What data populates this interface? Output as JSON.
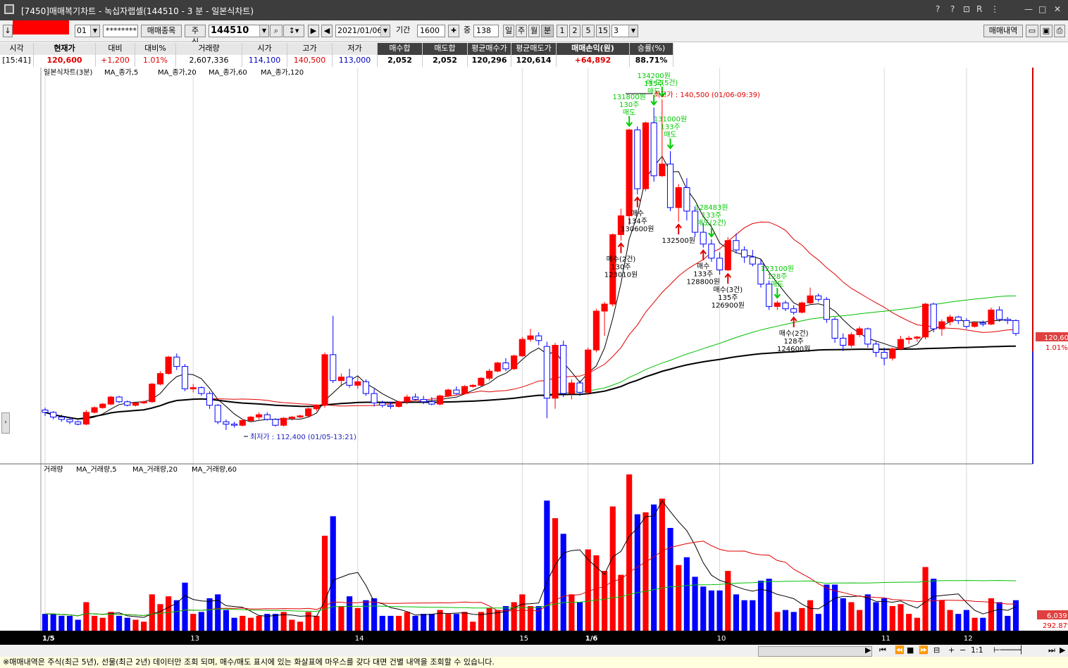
{
  "window": {
    "title": "[7450]매매복기차트 - 녹십자랩셀(144510 - 3 분 - 일본식차트)",
    "controls": [
      "?",
      "?",
      "⊡",
      "R",
      "⋮",
      "—",
      "□",
      "✕"
    ]
  },
  "toolbar": {
    "account_no": "01",
    "password": "********",
    "item_button": "매매종목",
    "type_label": "주식",
    "code": "144510",
    "date": "2021/01/06",
    "period_label": "기간",
    "period_value": "1600",
    "mid_label": "중",
    "mid_value": "138",
    "period_buttons": [
      "일",
      "주",
      "월",
      "분",
      "1",
      "2",
      "5",
      "15"
    ],
    "minute_value": "3",
    "trade_history_button": "매매내역",
    "arrow_left": "↓"
  },
  "summary": {
    "headers": [
      "시각",
      "현재가",
      "대비",
      "대비%",
      "거래량",
      "시가",
      "고가",
      "저가",
      "매수합",
      "매도합",
      "평균매수가",
      "평균매도가",
      "매매손익(원)",
      "승률(%)"
    ],
    "values": [
      "[15:41]",
      "120,600",
      "+1,200",
      "1.01%",
      "2,607,336",
      "114,100",
      "140,500",
      "113,000",
      "2,052",
      "2,052",
      "120,296",
      "120,614",
      "+64,892",
      "88.71%"
    ],
    "value_colors": [
      "#000000",
      "#e00000",
      "#e00000",
      "#e00000",
      "#000000",
      "#0000c0",
      "#e00000",
      "#0000c0",
      "#000000",
      "#000000",
      "#000000",
      "#000000",
      "#e00000",
      "#000000"
    ]
  },
  "price_panel": {
    "legend": [
      {
        "text": "일본식차트(3분)",
        "color": "#000000"
      },
      {
        "text": "MA_종가,5",
        "color": "#000000"
      },
      {
        "text": "MA_종가,20",
        "color": "#e00000"
      },
      {
        "text": "MA_종가,60",
        "color": "#00c000"
      },
      {
        "text": "MA_종가,120",
        "color": "#000000"
      }
    ],
    "high_label": "최고가 : 140,500 (01/06-09:39)",
    "low_label": "최저가 : 112,400 (01/05-13:21)",
    "last_price_tag": "120,600",
    "last_pct_tag": "1.01%",
    "trade_labels": [
      {
        "type": "sell",
        "lines": [
          "매 도(5건)"
        ]
      },
      {
        "type": "sell",
        "lines": [
          "131800원",
          "130주",
          "매도"
        ]
      },
      {
        "type": "sell",
        "lines": [
          "134200원",
          "135주",
          "매도"
        ]
      },
      {
        "type": "sell",
        "lines": [
          "131000원",
          "133주",
          "매도"
        ]
      },
      {
        "type": "sell",
        "lines": [
          "128483원",
          "133주",
          "매도(2건)"
        ]
      },
      {
        "type": "sell",
        "lines": [
          "123100원",
          "128주",
          "매도"
        ]
      },
      {
        "type": "buy",
        "lines": [
          "매수",
          "134주",
          "130600원"
        ]
      },
      {
        "type": "buy",
        "lines": [
          "매수(2건)",
          "130주",
          "123010원"
        ]
      },
      {
        "type": "buy",
        "lines": [
          "매수",
          "133주",
          "128800원"
        ]
      },
      {
        "type": "buy",
        "lines": [
          "매수(3건)",
          "135주",
          "126900원"
        ]
      },
      {
        "type": "buy",
        "lines": [
          "매수(2건)",
          "128주",
          "124600원"
        ]
      },
      {
        "type": "buy",
        "lines": [
          "132500원"
        ]
      }
    ]
  },
  "volume_panel": {
    "legend": [
      {
        "text": "거래량",
        "color": "#000000"
      },
      {
        "text": "MA_거래량,5",
        "color": "#000000"
      },
      {
        "text": "MA_거래량,20",
        "color": "#e00000"
      },
      {
        "text": "MA_거래량,60",
        "color": "#00c000"
      }
    ],
    "last_volume_tag": "6,039",
    "last_pct_tag": "292.87%"
  },
  "x_axis": {
    "labels": [
      "1/5",
      "13",
      "14",
      "15",
      "1/6",
      "10",
      "11",
      "12"
    ]
  },
  "navbar": {
    "zoom_label": "1:1"
  },
  "status": {
    "message": "※매매내역은 주식(최근 5년), 선물(최근 2년) 데이터만 조회 되며, 매수/매도 표시에 있는 화살표에 마우스를 갖다 대면 건별 내역을 조회할 수 있습니다."
  },
  "colors": {
    "up": "#ff0000",
    "down": "#0000ff",
    "ma5": "#000000",
    "ma20": "#e00000",
    "ma60": "#00c000",
    "ma120": "#000000",
    "sell_marker": "#00cc00",
    "buy_marker": "#e00000"
  },
  "chart_data": {
    "type": "candlestick",
    "interval": "3분",
    "y_range": [
      110000,
      142000
    ],
    "session_breaks": [
      "1/5",
      "1/6"
    ],
    "candles": [
      [
        114100,
        114300,
        113600,
        113900
      ],
      [
        113900,
        114000,
        113300,
        113500
      ],
      [
        113500,
        113700,
        113100,
        113300
      ],
      [
        113300,
        113500,
        112900,
        113100
      ],
      [
        113100,
        113200,
        112800,
        112900
      ],
      [
        112900,
        114100,
        112800,
        113900
      ],
      [
        113900,
        114400,
        113800,
        114300
      ],
      [
        114300,
        114700,
        114200,
        114600
      ],
      [
        114600,
        115300,
        114500,
        115200
      ],
      [
        115200,
        115300,
        114700,
        114800
      ],
      [
        114800,
        114900,
        114400,
        114500
      ],
      [
        114500,
        114800,
        114400,
        114700
      ],
      [
        114700,
        114900,
        114600,
        114800
      ],
      [
        114800,
        116400,
        114700,
        116300
      ],
      [
        116300,
        117400,
        116200,
        117200
      ],
      [
        117200,
        118700,
        117100,
        118600
      ],
      [
        118600,
        118900,
        117500,
        117800
      ],
      [
        117800,
        118000,
        115700,
        115900
      ],
      [
        115900,
        116300,
        115600,
        116000
      ],
      [
        116000,
        116100,
        115300,
        115500
      ],
      [
        115500,
        115700,
        114200,
        114500
      ],
      [
        114500,
        114600,
        112900,
        113100
      ],
      [
        113100,
        113300,
        112400,
        112900
      ],
      [
        112900,
        113100,
        112600,
        112800
      ],
      [
        112800,
        113300,
        112700,
        113200
      ],
      [
        113200,
        113600,
        113100,
        113500
      ],
      [
        113500,
        113900,
        113300,
        113700
      ],
      [
        113700,
        113900,
        113200,
        113300
      ],
      [
        113300,
        113400,
        112700,
        112800
      ],
      [
        112800,
        113500,
        112700,
        113400
      ],
      [
        113400,
        113600,
        113200,
        113500
      ],
      [
        113500,
        113700,
        113400,
        113600
      ],
      [
        113600,
        114300,
        113500,
        114200
      ],
      [
        114200,
        114600,
        114000,
        114500
      ],
      [
        114500,
        119000,
        114300,
        118800
      ],
      [
        118800,
        122100,
        116400,
        116600
      ],
      [
        116600,
        117200,
        116100,
        116900
      ],
      [
        116900,
        117600,
        116000,
        116200
      ],
      [
        116200,
        116900,
        115900,
        116500
      ],
      [
        116500,
        116700,
        115300,
        115500
      ],
      [
        115500,
        115900,
        114400,
        114700
      ],
      [
        114700,
        114900,
        114300,
        114500
      ],
      [
        114500,
        114800,
        114200,
        114400
      ],
      [
        114400,
        114900,
        114300,
        114800
      ],
      [
        114800,
        115400,
        114600,
        115200
      ],
      [
        115200,
        115500,
        114900,
        115000
      ],
      [
        115000,
        115300,
        114600,
        114800
      ],
      [
        114800,
        115200,
        114500,
        114600
      ],
      [
        114600,
        115400,
        114500,
        115300
      ],
      [
        115300,
        115900,
        115200,
        115800
      ],
      [
        115800,
        116100,
        115400,
        115500
      ],
      [
        115500,
        116200,
        115400,
        116100
      ],
      [
        116100,
        116300,
        116000,
        116200
      ],
      [
        116200,
        116900,
        116100,
        116800
      ],
      [
        116800,
        117600,
        116600,
        117400
      ],
      [
        117400,
        118200,
        117300,
        118100
      ],
      [
        118100,
        118500,
        117400,
        117600
      ],
      [
        117600,
        118800,
        117500,
        118700
      ],
      [
        118700,
        120300,
        118600,
        120100
      ],
      [
        120100,
        121000,
        119900,
        120400
      ],
      [
        120400,
        120700,
        119600,
        120000
      ],
      [
        119500,
        119900,
        113400,
        115100
      ],
      [
        115100,
        119800,
        114200,
        119600
      ],
      [
        119600,
        120000,
        115200,
        115500
      ],
      [
        115500,
        116700,
        115000,
        116400
      ],
      [
        116400,
        116600,
        115300,
        115600
      ],
      [
        115600,
        119400,
        115400,
        119200
      ],
      [
        119200,
        122700,
        119000,
        122500
      ],
      [
        122500,
        123300,
        120400,
        123100
      ],
      [
        123100,
        129100,
        122900,
        129000
      ],
      [
        129000,
        131200,
        128500,
        130600
      ],
      [
        130600,
        138000,
        129800,
        137900
      ],
      [
        137900,
        138200,
        132400,
        132900
      ],
      [
        132900,
        138600,
        132700,
        138500
      ],
      [
        138500,
        139800,
        133500,
        134000
      ],
      [
        134000,
        140500,
        133900,
        135000
      ],
      [
        135000,
        136100,
        131000,
        131300
      ],
      [
        131300,
        133300,
        130100,
        133000
      ],
      [
        133000,
        133800,
        130200,
        131000
      ],
      [
        131000,
        131400,
        128800,
        129200
      ],
      [
        129200,
        130000,
        127900,
        128200
      ],
      [
        128200,
        128600,
        126700,
        127000
      ],
      [
        127000,
        127500,
        125600,
        126000
      ],
      [
        126000,
        128800,
        125900,
        128500
      ],
      [
        128500,
        129100,
        127400,
        127700
      ],
      [
        127700,
        128000,
        126600,
        127100
      ],
      [
        127100,
        127700,
        126300,
        126500
      ],
      [
        126500,
        126900,
        124500,
        124800
      ],
      [
        124800,
        125100,
        122600,
        122900
      ],
      [
        122900,
        123400,
        122600,
        123200
      ],
      [
        123200,
        123400,
        122500,
        122700
      ],
      [
        122700,
        123000,
        122200,
        122400
      ],
      [
        122400,
        123300,
        122300,
        123200
      ],
      [
        123200,
        124500,
        123100,
        123800
      ],
      [
        123800,
        124000,
        123300,
        123500
      ],
      [
        123500,
        123700,
        121500,
        121800
      ],
      [
        121800,
        122000,
        119800,
        120200
      ],
      [
        120200,
        120600,
        119100,
        119600
      ],
      [
        119600,
        120700,
        119400,
        120500
      ],
      [
        120500,
        121200,
        120300,
        121000
      ],
      [
        121000,
        121100,
        119400,
        119700
      ],
      [
        119700,
        119900,
        118600,
        119000
      ],
      [
        119000,
        119400,
        117900,
        118500
      ],
      [
        118500,
        119400,
        118300,
        119300
      ],
      [
        119300,
        120400,
        119200,
        120100
      ],
      [
        120100,
        120400,
        119700,
        120200
      ],
      [
        120200,
        120400,
        119900,
        120300
      ],
      [
        120300,
        123200,
        120100,
        123100
      ],
      [
        123100,
        123200,
        120700,
        121000
      ],
      [
        121000,
        121800,
        120400,
        121600
      ],
      [
        121600,
        122200,
        121300,
        122000
      ],
      [
        122000,
        122100,
        121400,
        121700
      ],
      [
        121700,
        121900,
        121000,
        121200
      ],
      [
        121200,
        121600,
        121100,
        121500
      ],
      [
        121500,
        121700,
        121200,
        121400
      ],
      [
        121400,
        122800,
        121300,
        122600
      ],
      [
        122600,
        122900,
        121600,
        121800
      ],
      [
        121800,
        122000,
        121400,
        121700
      ],
      [
        121700,
        121800,
        120400,
        120600
      ]
    ],
    "volume_scale_max": 100
  }
}
